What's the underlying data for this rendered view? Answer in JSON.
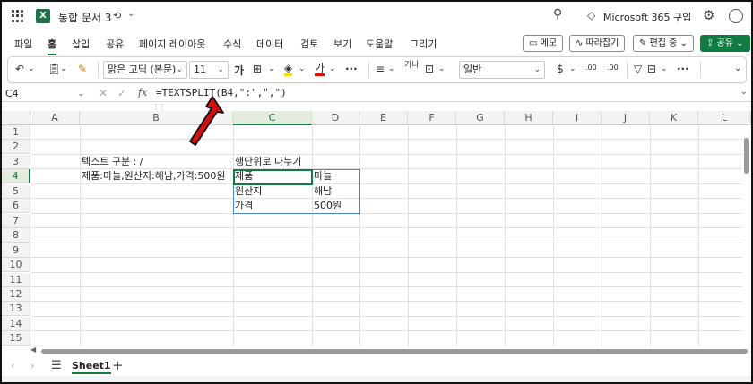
{
  "app": {
    "logo_letter": "X",
    "doc_title": "통합 문서 3",
    "ms365": "Microsoft 365 구입"
  },
  "ribbon_tabs": [
    "파일",
    "홈",
    "삽입",
    "공유",
    "페이지 레이아웃",
    "수식",
    "데이터",
    "검토",
    "보기",
    "도움말",
    "그리기"
  ],
  "active_tab": "홈",
  "ribbon_buttons": {
    "memo": "메모",
    "follow": "따라잡기",
    "edit": "편집 중",
    "share": "공유"
  },
  "toolbar": {
    "font_name": "맑은 고딕 (본문)",
    "font_size": "11",
    "bold": "가",
    "font_color_glyph": "가",
    "number_format": "일반",
    "currency": "$",
    "dec_inc": ".00",
    "dec_dec": ".00",
    "wrap_glyph": "가나"
  },
  "formula_bar": {
    "name_box": "C4",
    "fx": "fx",
    "formula": "=TEXTSPLIT(B4,\":\",\",\")"
  },
  "columns": [
    "A",
    "B",
    "C",
    "D",
    "E",
    "F",
    "G",
    "H",
    "I",
    "J",
    "K",
    "L"
  ],
  "rows": [
    "1",
    "2",
    "3",
    "4",
    "5",
    "6",
    "7",
    "8",
    "9",
    "10",
    "11",
    "12",
    "13",
    "14",
    "15"
  ],
  "cells": {
    "B3": "텍스트 구분 : /",
    "B4": "제품:마늘,원산지:해남,가격:500원",
    "C3": "행단위로 나누기",
    "C4": "제품",
    "D4": "마늘",
    "C5": "원산지",
    "D5": "해남",
    "C6": "가격",
    "D6": "500원"
  },
  "sheets": [
    "Sheet1"
  ],
  "colors": {
    "accent": "#107c41",
    "spill_border": "#4a86c8",
    "arrow": "#d21010"
  }
}
